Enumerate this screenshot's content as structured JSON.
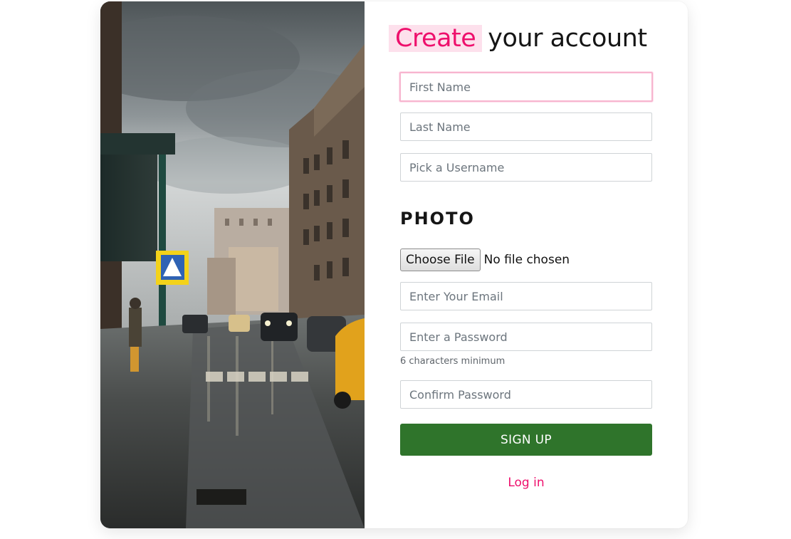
{
  "heading": {
    "highlight": "Create",
    "rest": "your account"
  },
  "fields": {
    "first_name": {
      "placeholder": "First Name",
      "value": ""
    },
    "last_name": {
      "placeholder": "Last Name",
      "value": ""
    },
    "username": {
      "placeholder": "Pick a Username",
      "value": ""
    },
    "email": {
      "placeholder": "Enter Your Email",
      "value": ""
    },
    "password": {
      "placeholder": "Enter a Password",
      "value": ""
    },
    "confirm_password": {
      "placeholder": "Confirm Password",
      "value": ""
    }
  },
  "photo_section": {
    "label": "PHOTO",
    "choose_button": "Choose File",
    "status": "No file chosen"
  },
  "password_hint": "6 characters minimum",
  "buttons": {
    "signup": "SIGN UP"
  },
  "links": {
    "login": "Log in"
  },
  "colors": {
    "accent": "#ee0f6c",
    "accent_bg": "#fde0ec",
    "button_green": "#2f742b",
    "focus_border": "#f7b5cf"
  }
}
